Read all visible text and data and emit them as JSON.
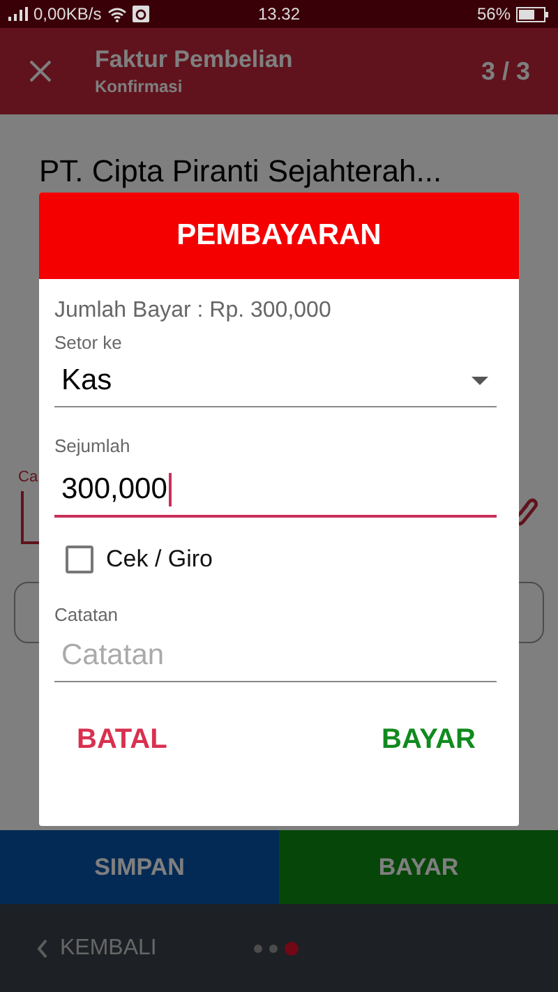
{
  "status_bar": {
    "speed": "0,00KB/s",
    "time": "13.32",
    "battery": "56%"
  },
  "header": {
    "title": "Faktur Pembelian",
    "subtitle": "Konfirmasi",
    "step": "3 / 3"
  },
  "company": "PT. Cipta Piranti Sejahterah...",
  "field_label": "Ca",
  "actions": [
    {
      "label": "SIMPAN",
      "kind": "save"
    },
    {
      "label": "BAYAR",
      "kind": "pay"
    }
  ],
  "nav": {
    "back": "KEMBALI",
    "pages": [
      {
        "selected": false
      },
      {
        "selected": false
      },
      {
        "selected": true
      }
    ]
  },
  "dialog": {
    "title": "PEMBAYARAN",
    "amount_text": "Jumlah Bayar : Rp. 300,000",
    "deposit_label": "Setor ke",
    "deposit_value": "Kas",
    "amount_label": "Sejumlah",
    "amount_value": "300,000",
    "cek_giro": {
      "label": "Cek / Giro",
      "checked": false
    },
    "note_label": "Catatan",
    "note_placeholder": "Catatan",
    "buttons": [
      {
        "label": "BATAL",
        "kind": "cancel"
      },
      {
        "label": "BAYAR",
        "kind": "confirm"
      }
    ]
  }
}
